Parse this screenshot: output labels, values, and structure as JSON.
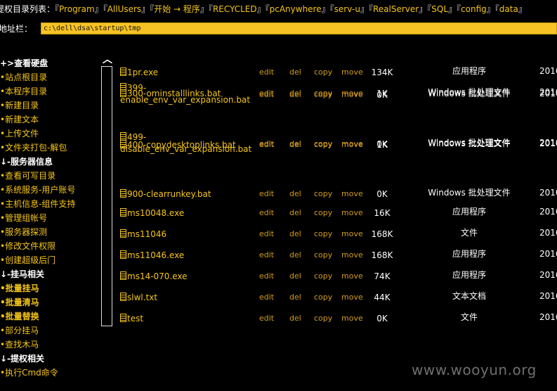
{
  "topbar": {
    "label": "提权目录列表：",
    "links": [
      "Program",
      "AllUsers",
      "开始 → 程序",
      "RECYCLED",
      "pcAnywhere",
      "serv-u",
      "RealServer",
      "SQL",
      "config",
      "data"
    ]
  },
  "address": {
    "label": "地址栏：",
    "value": "c:\\dell\\dsa\\startup\\tmp"
  },
  "sidebar": [
    {
      "text": "+>查看硬盘",
      "kind": "hdr"
    },
    {
      "text": "•站点根目录",
      "kind": "item"
    },
    {
      "text": "•本程序目录",
      "kind": "item"
    },
    {
      "text": "•新建目录",
      "kind": "item"
    },
    {
      "text": "•新建文本",
      "kind": "item"
    },
    {
      "text": "•上传文件",
      "kind": "item"
    },
    {
      "text": "•文件夹打包-解包",
      "kind": "item"
    },
    {
      "text": "↓-服务器信息",
      "kind": "hdr"
    },
    {
      "text": "•查看可写目录",
      "kind": "item"
    },
    {
      "text": "•系统服务-用户账号",
      "kind": "item"
    },
    {
      "text": "•主机信息-组件支持",
      "kind": "item"
    },
    {
      "text": "•管理组帐号",
      "kind": "item"
    },
    {
      "text": "•服务器探测",
      "kind": "item"
    },
    {
      "text": "•修改文件权限",
      "kind": "item"
    },
    {
      "text": "•创建超级后门",
      "kind": "item"
    },
    {
      "text": "↓-挂马相关",
      "kind": "hdr"
    },
    {
      "text": "•批量挂马",
      "kind": "bold"
    },
    {
      "text": "•批量清马",
      "kind": "bold"
    },
    {
      "text": "•批量替换",
      "kind": "bold"
    },
    {
      "text": "•部分挂马",
      "kind": "item"
    },
    {
      "text": "•查找木马",
      "kind": "item"
    },
    {
      "text": "↓-提权相关",
      "kind": "hdr"
    },
    {
      "text": "•执行Cmd命令",
      "kind": "item"
    }
  ],
  "actions": {
    "edit": "edit",
    "del": "del",
    "copy": "copy",
    "move": "move"
  },
  "files": [
    {
      "name": "1pr.exe",
      "size": "134K",
      "type": "应用程序",
      "date": "2016"
    },
    {
      "name": "300-ominstalllinks.bat",
      "size": "1K",
      "type": "Windows 批处理文件",
      "date": "2010"
    },
    {
      "name": "399-\nenable_env_var_expansion.bat",
      "size": "0K",
      "type": "Windows 批处理文件",
      "date": "2010"
    },
    {
      "name": "400-copydesktoplinks.bat",
      "size": "1K",
      "type": "Windows 批处理文件",
      "date": "2010"
    },
    {
      "name": "499-\ndisable_env_var_expansion.bat",
      "size": "0K",
      "type": "Windows 批处理文件",
      "date": "2010"
    },
    {
      "name": "900-clearrunkey.bat",
      "size": "0K",
      "type": "Windows 批处理文件",
      "date": "2010"
    },
    {
      "name": "ms10048.exe",
      "size": "16K",
      "type": "应用程序",
      "date": "2016"
    },
    {
      "name": "ms11046",
      "size": "168K",
      "type": "文件",
      "date": "2016"
    },
    {
      "name": "ms11046.exe",
      "size": "168K",
      "type": "应用程序",
      "date": "2016"
    },
    {
      "name": "ms14-070.exe",
      "size": "74K",
      "type": "应用程序",
      "date": "2016"
    },
    {
      "name": "slwl.txt",
      "size": "44K",
      "type": "文本文档",
      "date": "2016"
    },
    {
      "name": "test",
      "size": "0K",
      "type": "文件",
      "date": "2016"
    }
  ],
  "scrollbar": {
    "up_glyph": "︿"
  },
  "watermark": "www.wooyun.org"
}
